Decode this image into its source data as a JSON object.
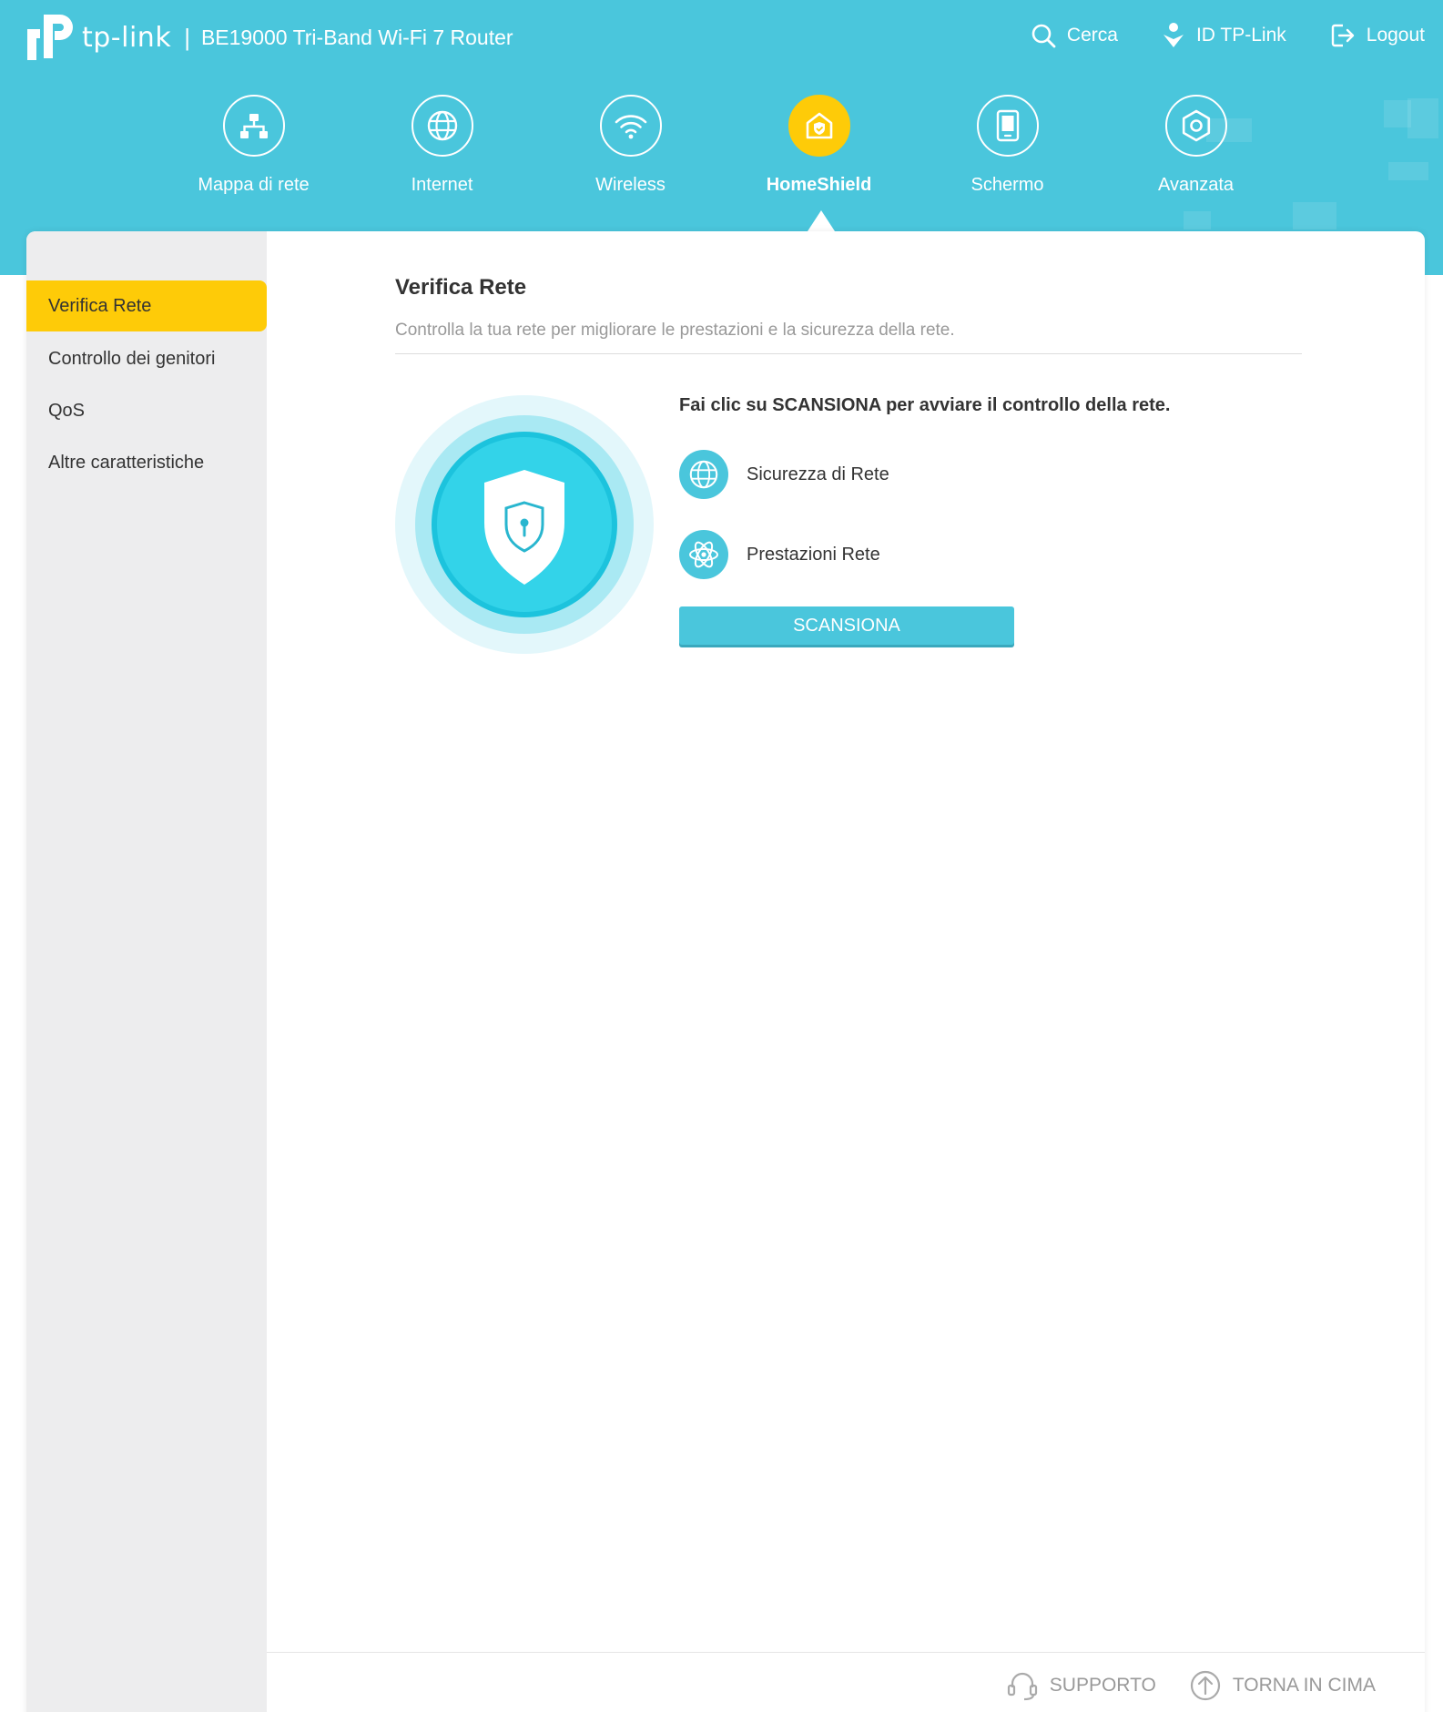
{
  "header": {
    "brand": "tp-link",
    "separator": "|",
    "model": "BE19000 Tri-Band Wi-Fi 7 Router",
    "actions": [
      {
        "label": "Cerca",
        "icon": "search-icon"
      },
      {
        "label": "ID TP-Link",
        "icon": "tplink-id-icon"
      },
      {
        "label": "Logout",
        "icon": "logout-icon"
      }
    ]
  },
  "nav": {
    "items": [
      {
        "label": "Mappa di rete",
        "icon": "network-map-icon",
        "active": false
      },
      {
        "label": "Internet",
        "icon": "globe-icon",
        "active": false
      },
      {
        "label": "Wireless",
        "icon": "wifi-icon",
        "active": false
      },
      {
        "label": "HomeShield",
        "icon": "homeshield-icon",
        "active": true
      },
      {
        "label": "Schermo",
        "icon": "screen-icon",
        "active": false
      },
      {
        "label": "Avanzata",
        "icon": "gear-icon",
        "active": false
      }
    ]
  },
  "sidebar": {
    "items": [
      {
        "label": "Verifica Rete",
        "active": true
      },
      {
        "label": "Controllo dei genitori",
        "active": false
      },
      {
        "label": "QoS",
        "active": false
      },
      {
        "label": "Altre caratteristiche",
        "active": false
      }
    ]
  },
  "main": {
    "title": "Verifica Rete",
    "description": "Controlla la tua rete per migliorare le prestazioni e la sicurezza della rete.",
    "scan_heading": "Fai clic su SCANSIONA per avviare il controllo della rete.",
    "features": [
      {
        "label": "Sicurezza di Rete",
        "icon": "globe-icon"
      },
      {
        "label": "Prestazioni Rete",
        "icon": "atom-icon"
      }
    ],
    "scan_button": "SCANSIONA"
  },
  "footer": {
    "support": "SUPPORTO",
    "back_to_top": "TORNA IN CIMA"
  },
  "colors": {
    "header": "#4ac6dc",
    "accent_yellow": "#fecb08",
    "sidebar_bg": "#ededee"
  }
}
